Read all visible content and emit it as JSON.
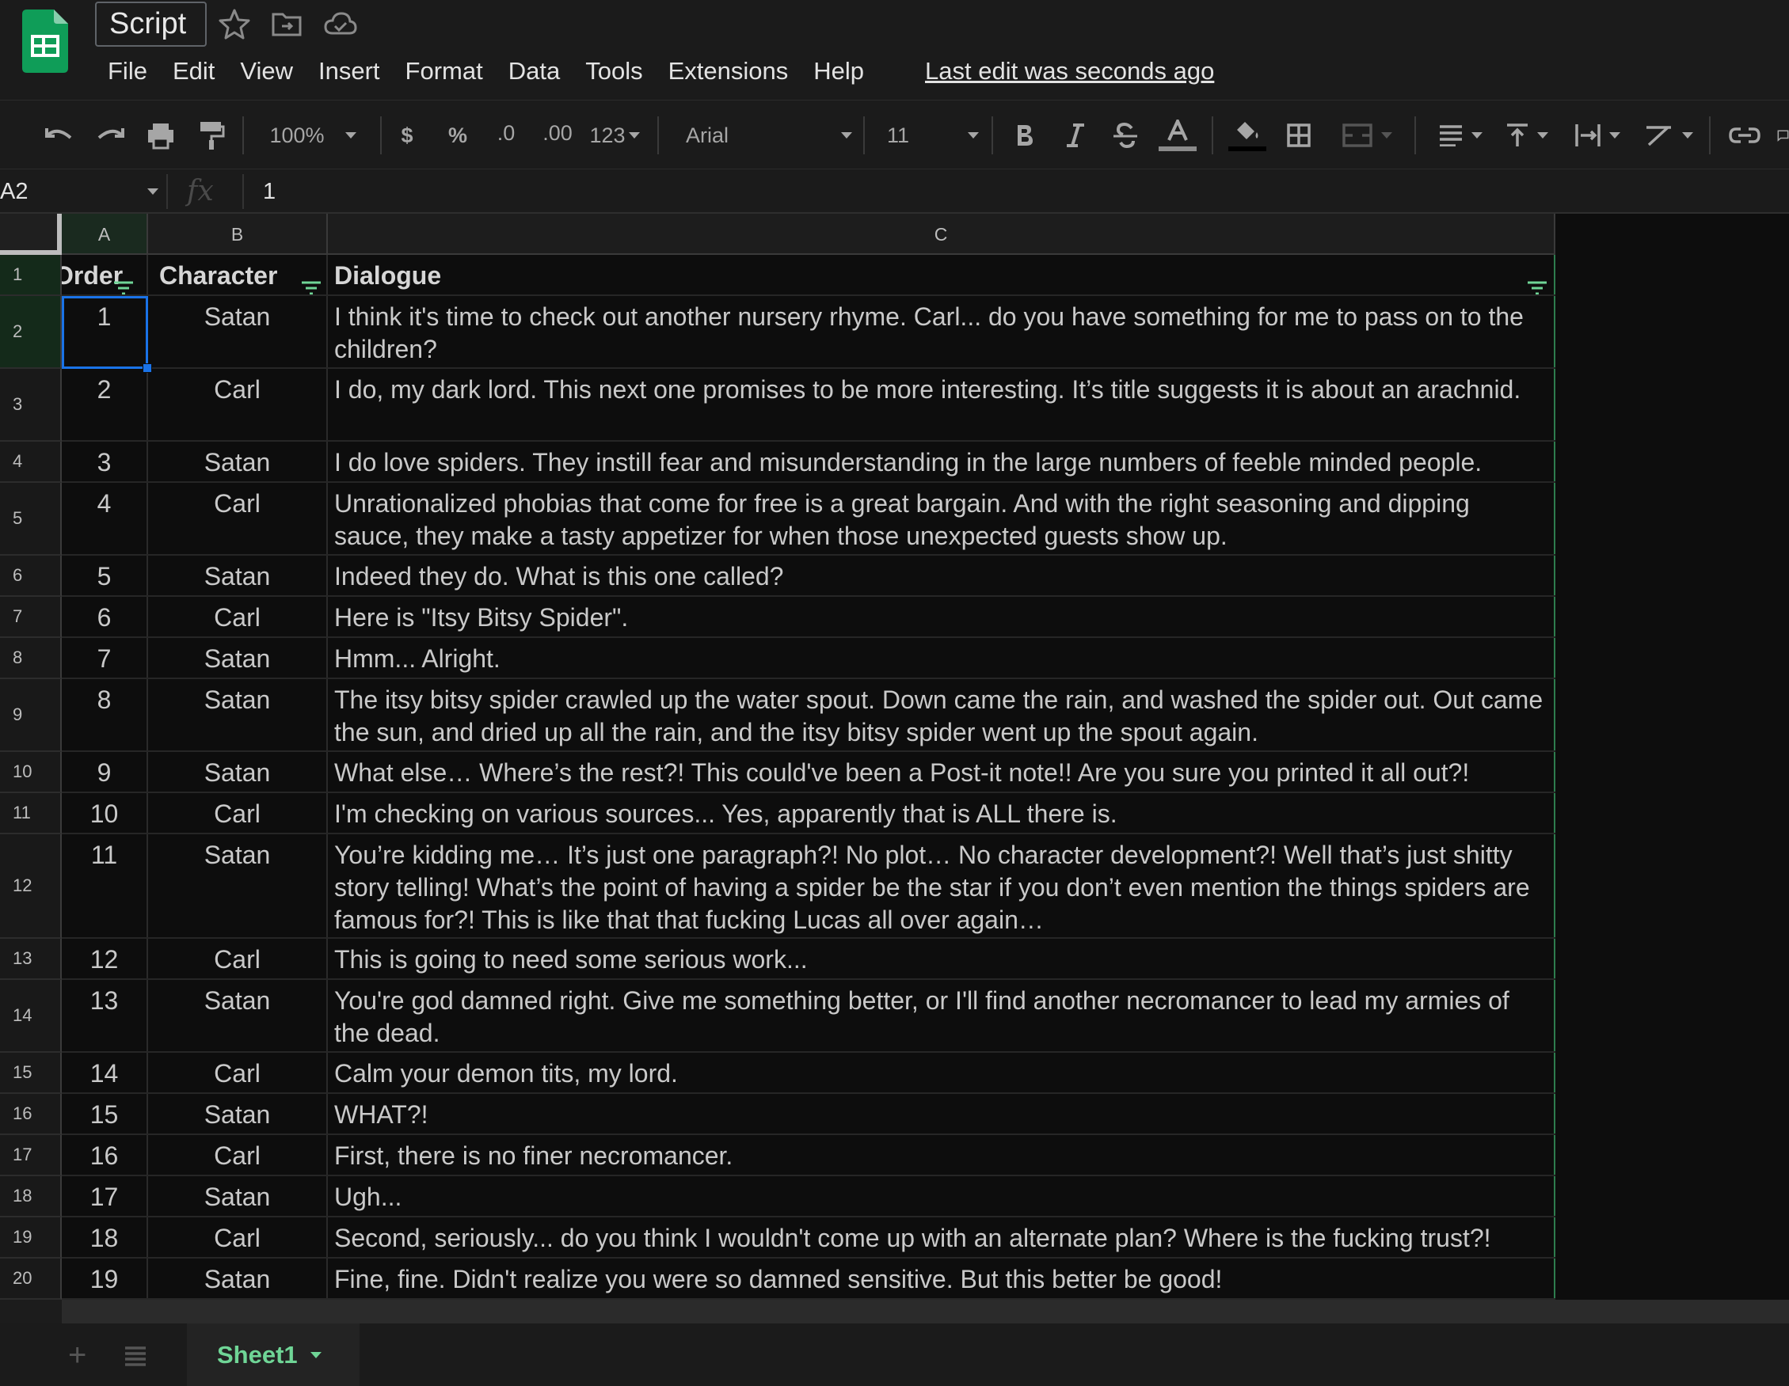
{
  "app": {
    "doc_title": "Script",
    "last_edit": "Last edit was seconds ago",
    "menu": [
      "File",
      "Edit",
      "View",
      "Insert",
      "Format",
      "Data",
      "Tools",
      "Extensions",
      "Help"
    ]
  },
  "toolbar": {
    "zoom": "100%",
    "currency": "$",
    "percent": "%",
    "decrease_decimal": ".0",
    "increase_decimal": ".00",
    "more_formats": "123",
    "font_family": "Arial",
    "font_size": "11"
  },
  "formula_bar": {
    "name_box": "A2",
    "fx": "fx",
    "value": "1"
  },
  "columns": [
    "A",
    "B",
    "C"
  ],
  "header_row": {
    "row_num": "1",
    "order": "Order",
    "character": "Character",
    "dialogue": "Dialogue"
  },
  "rows": [
    {
      "row_num": "2",
      "order": "1",
      "character": "Satan",
      "dialogue": "I think it's time to check out another nursery rhyme. Carl... do you have something for me to pass on to the children?"
    },
    {
      "row_num": "3",
      "order": "2",
      "character": "Carl",
      "dialogue": "I do, my dark lord. This next one promises to be more interesting. It’s title suggests it is about an arachnid."
    },
    {
      "row_num": "4",
      "order": "3",
      "character": "Satan",
      "dialogue": "I do love spiders. They instill fear and misunderstanding in the large numbers of feeble minded people."
    },
    {
      "row_num": "5",
      "order": "4",
      "character": "Carl",
      "dialogue": "Unrationalized phobias that come for free is a great bargain. And with the right seasoning and dipping sauce, they make a tasty appetizer for when those unexpected guests show up."
    },
    {
      "row_num": "6",
      "order": "5",
      "character": "Satan",
      "dialogue": "Indeed they do. What is this one called?"
    },
    {
      "row_num": "7",
      "order": "6",
      "character": "Carl",
      "dialogue": "Here is \"Itsy Bitsy Spider\"."
    },
    {
      "row_num": "8",
      "order": "7",
      "character": "Satan",
      "dialogue": "Hmm... Alright."
    },
    {
      "row_num": "9",
      "order": "8",
      "character": "Satan",
      "dialogue": "The itsy bitsy spider crawled up the water spout. Down came the rain, and washed the spider out. Out came the sun, and dried up all the rain, and the itsy bitsy spider went up the spout again."
    },
    {
      "row_num": "10",
      "order": "9",
      "character": "Satan",
      "dialogue": "What else… Where’s the rest?! This could've been a Post-it note!! Are you sure you printed it all out?!"
    },
    {
      "row_num": "11",
      "order": "10",
      "character": "Carl",
      "dialogue": "I'm checking on various sources... Yes, apparently that is ALL there is."
    },
    {
      "row_num": "12",
      "order": "11",
      "character": "Satan",
      "dialogue": "You’re kidding me… It’s just one paragraph?! No plot… No character development?! Well that’s just shitty story telling! What’s the point of having a spider be the star if you don’t even mention the things spiders are famous for?! This is like that that fucking Lucas all over again…"
    },
    {
      "row_num": "13",
      "order": "12",
      "character": "Carl",
      "dialogue": "This is going to need some serious work..."
    },
    {
      "row_num": "14",
      "order": "13",
      "character": "Satan",
      "dialogue": "You're god damned right. Give me something better, or I'll find another necromancer to lead my armies of the dead."
    },
    {
      "row_num": "15",
      "order": "14",
      "character": "Carl",
      "dialogue": "Calm your demon tits, my lord."
    },
    {
      "row_num": "16",
      "order": "15",
      "character": "Satan",
      "dialogue": "WHAT?!"
    },
    {
      "row_num": "17",
      "order": "16",
      "character": "Carl",
      "dialogue": "First, there is no finer necromancer."
    },
    {
      "row_num": "18",
      "order": "17",
      "character": "Satan",
      "dialogue": "Ugh..."
    },
    {
      "row_num": "19",
      "order": "18",
      "character": "Carl",
      "dialogue": "Second, seriously... do you think I wouldn't come up with an alternate plan? Where is the fucking trust?!"
    },
    {
      "row_num": "20",
      "order": "19",
      "character": "Satan",
      "dialogue": "Fine, fine. Didn't realize you were so damned sensitive. But this better be good!"
    }
  ],
  "sheets": {
    "add_icon": "+",
    "active": "Sheet1"
  },
  "colors": {
    "accent_green": "#6fd596",
    "selection_blue": "#1a73e8",
    "logo_green": "#0f9d58"
  }
}
